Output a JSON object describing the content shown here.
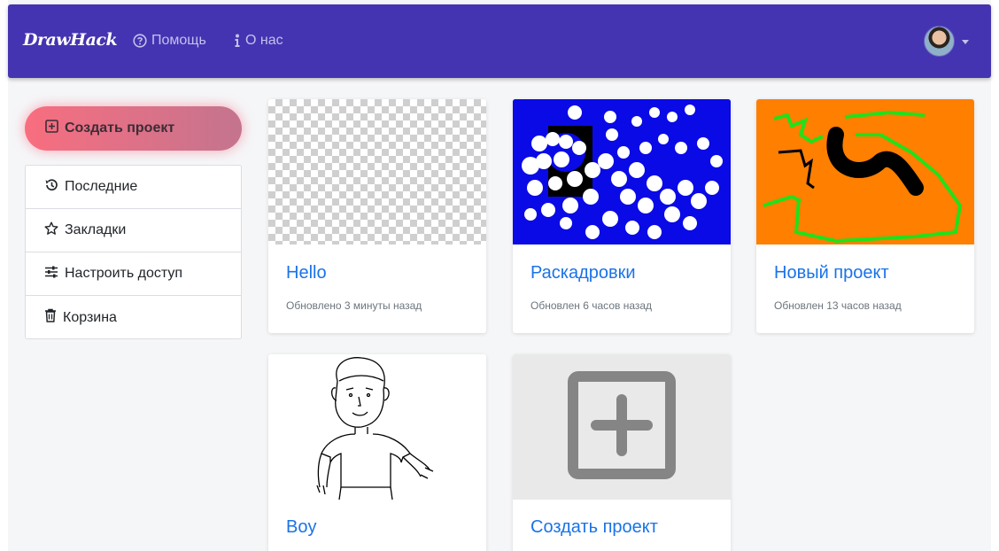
{
  "navbar": {
    "brand": "DrawHack",
    "help_label": "Помощь",
    "about_label": "О нас",
    "color": "#4434b1"
  },
  "sidebar": {
    "create_label": "Создать проект",
    "items": [
      {
        "label": "Последние",
        "icon": "history-icon"
      },
      {
        "label": "Закладки",
        "icon": "star-icon"
      },
      {
        "label": "Настроить доступ",
        "icon": "sliders-icon"
      },
      {
        "label": "Корзина",
        "icon": "trash-icon"
      }
    ]
  },
  "projects": [
    {
      "title": "Hello",
      "updated": "Обновлено 3 минуты назад",
      "thumbnail": "transparent-checkerboard"
    },
    {
      "title": "Раскадровки",
      "updated": "Обновлен 6 часов назад",
      "thumbnail": "blue-white-scribbles"
    },
    {
      "title": "Новый проект",
      "updated": "Обновлен 13 часов назад",
      "thumbnail": "orange-green-black-scribbles"
    },
    {
      "title": "Boy",
      "updated": "",
      "thumbnail": "boy-line-drawing"
    }
  ],
  "new_project_card": {
    "title": "Создать проект",
    "icon": "plus-square-icon"
  },
  "colors": {
    "link": "#1a73e8",
    "accent_pink": "#f86e7f"
  }
}
